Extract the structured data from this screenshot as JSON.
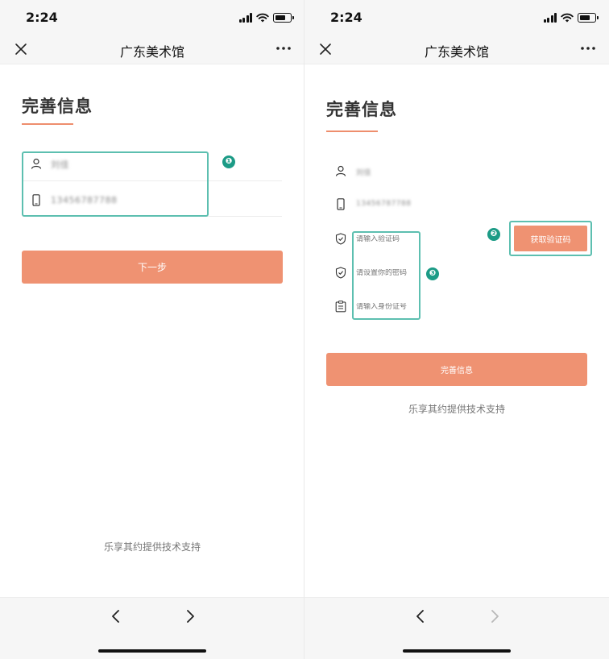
{
  "screens": [
    {
      "status_time": "2:24",
      "nav_title": "广东美术馆",
      "page_title": "完善信息",
      "fields": [
        {
          "icon": "user-icon",
          "value": "刘佳"
        },
        {
          "icon": "phone-icon",
          "value": "13456787788"
        }
      ],
      "badge": "❶",
      "button_label": "下一步",
      "footer": "乐享其约提供技术支持",
      "nav_back_enabled": true,
      "nav_forward_enabled": true
    },
    {
      "status_time": "2:24",
      "nav_title": "广东美术馆",
      "page_title": "完善信息",
      "fields": [
        {
          "icon": "user-icon",
          "value": "刘佳"
        },
        {
          "icon": "phone-icon",
          "value": "13456787788"
        },
        {
          "icon": "shield-icon",
          "placeholder": "请输入验证码"
        },
        {
          "icon": "shield-icon",
          "placeholder": "请设置你的密码"
        },
        {
          "icon": "id-card-icon",
          "placeholder": "请输入身份证号"
        }
      ],
      "badges": [
        "❷",
        "❸"
      ],
      "code_button_label": "获取验证码",
      "button_label": "完善信息",
      "footer": "乐享其约提供技术支持",
      "nav_back_enabled": true,
      "nav_forward_enabled": false
    }
  ],
  "colors": {
    "accent": "#ef9272",
    "highlight": "#5dbfb0",
    "badge": "#1c9b86"
  }
}
